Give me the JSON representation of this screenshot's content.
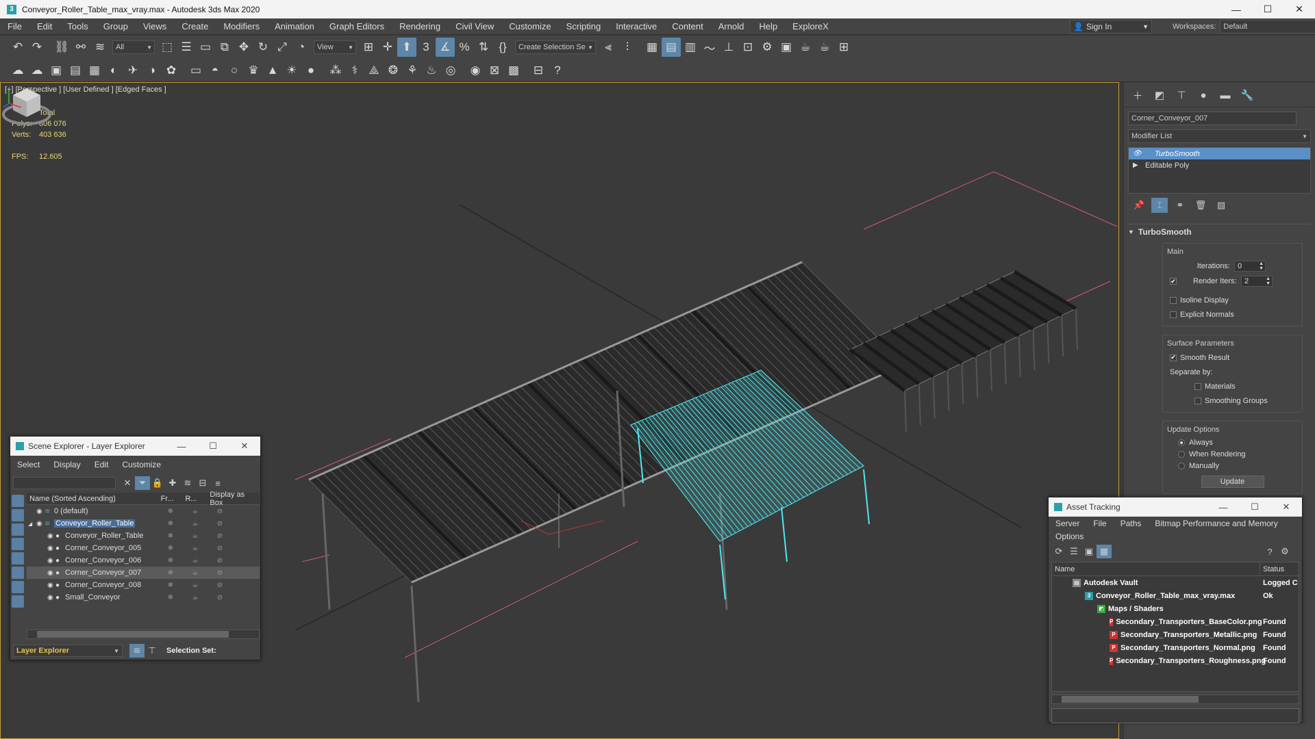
{
  "title_bar": {
    "title": "Conveyor_Roller_Table_max_vray.max - Autodesk 3ds Max 2020",
    "minimize": "—",
    "maximize": "☐",
    "close": "✕"
  },
  "menu": {
    "items": [
      "File",
      "Edit",
      "Tools",
      "Group",
      "Views",
      "Create",
      "Modifiers",
      "Animation",
      "Graph Editors",
      "Rendering",
      "Civil View",
      "Customize",
      "Scripting",
      "Interactive",
      "Content",
      "Arnold",
      "Help",
      "ExploreX"
    ],
    "sign_in": "Sign In",
    "workspaces_label": "Workspaces:",
    "workspace_value": "Default"
  },
  "toolbar": {
    "selection_filter": "All",
    "ref_coord": "View",
    "named_selection": "Create Selection Se"
  },
  "viewport": {
    "label": "[+] [Perspective ] [User Defined ] [Edged Faces ]",
    "stats": {
      "total_label": "Total",
      "polys_label": "Polys:",
      "polys_value": "806 076",
      "verts_label": "Verts:",
      "verts_value": "403 636",
      "fps_label": "FPS:",
      "fps_value": "12.605"
    }
  },
  "command_panel": {
    "object_name": "Corner_Conveyor_007",
    "modifier_list": "Modifier List",
    "stack": [
      {
        "label": "TurboSmooth",
        "selected": true
      },
      {
        "label": "Editable Poly",
        "selected": false
      }
    ],
    "turbosmooth": {
      "title": "TurboSmooth",
      "main_group": "Main",
      "iterations_label": "Iterations:",
      "iterations_value": "0",
      "render_iters_label": "Render Iters:",
      "render_iters_value": "2",
      "render_iters_checked": true,
      "isoline_label": "Isoline Display",
      "explicit_normals_label": "Explicit Normals",
      "surface_group": "Surface Parameters",
      "smooth_result_label": "Smooth Result",
      "separate_by_label": "Separate by:",
      "materials_label": "Materials",
      "smoothing_groups_label": "Smoothing Groups",
      "update_group": "Update Options",
      "always_label": "Always",
      "when_rendering_label": "When Rendering",
      "manually_label": "Manually",
      "update_button": "Update"
    }
  },
  "scene_explorer": {
    "title": "Scene Explorer - Layer Explorer",
    "menu": [
      "Select",
      "Display",
      "Edit",
      "Customize"
    ],
    "columns": [
      "Name (Sorted Ascending)",
      "Fr...",
      "R...",
      "Display as Box"
    ],
    "rows": [
      {
        "name": "0 (default)",
        "indent": 0,
        "kind": "layer",
        "selected": false
      },
      {
        "name": "Conveyor_Roller_Table",
        "indent": 0,
        "kind": "layer-active",
        "selected": false
      },
      {
        "name": "Conveyor_Roller_Table",
        "indent": 1,
        "kind": "object",
        "selected": false
      },
      {
        "name": "Corner_Conveyor_005",
        "indent": 1,
        "kind": "object",
        "selected": false
      },
      {
        "name": "Corner_Conveyor_006",
        "indent": 1,
        "kind": "object",
        "selected": false
      },
      {
        "name": "Corner_Conveyor_007",
        "indent": 1,
        "kind": "object",
        "selected": true
      },
      {
        "name": "Corner_Conveyor_008",
        "indent": 1,
        "kind": "object",
        "selected": false
      },
      {
        "name": "Small_Conveyor",
        "indent": 1,
        "kind": "object",
        "selected": false
      }
    ],
    "explorer_type": "Layer Explorer",
    "selection_set_label": "Selection Set:"
  },
  "asset_tracking": {
    "title": "Asset Tracking",
    "menu": [
      "Server",
      "File",
      "Paths",
      "Bitmap Performance and Memory"
    ],
    "menu2": "Options",
    "columns": [
      "Name",
      "Status"
    ],
    "rows": [
      {
        "name": "Autodesk Vault",
        "status": "Logged C",
        "indent": 0,
        "icon": "vault"
      },
      {
        "name": "Conveyor_Roller_Table_max_vray.max",
        "status": "Ok",
        "indent": 1,
        "icon": "max"
      },
      {
        "name": "Maps / Shaders",
        "status": "",
        "indent": 2,
        "icon": "maps"
      },
      {
        "name": "Secondary_Transporters_BaseColor.png",
        "status": "Found",
        "indent": 3,
        "icon": "png"
      },
      {
        "name": "Secondary_Transporters_Metallic.png",
        "status": "Found",
        "indent": 3,
        "icon": "png"
      },
      {
        "name": "Secondary_Transporters_Normal.png",
        "status": "Found",
        "indent": 3,
        "icon": "png"
      },
      {
        "name": "Secondary_Transporters_Roughness.png",
        "status": "Found",
        "indent": 3,
        "icon": "png"
      }
    ]
  },
  "colors": {
    "selection_highlight": "#5b8fc7",
    "selected_object": "#4fe8f0",
    "viewport_border": "#c8a038",
    "stats_text": "#e6d77a"
  }
}
